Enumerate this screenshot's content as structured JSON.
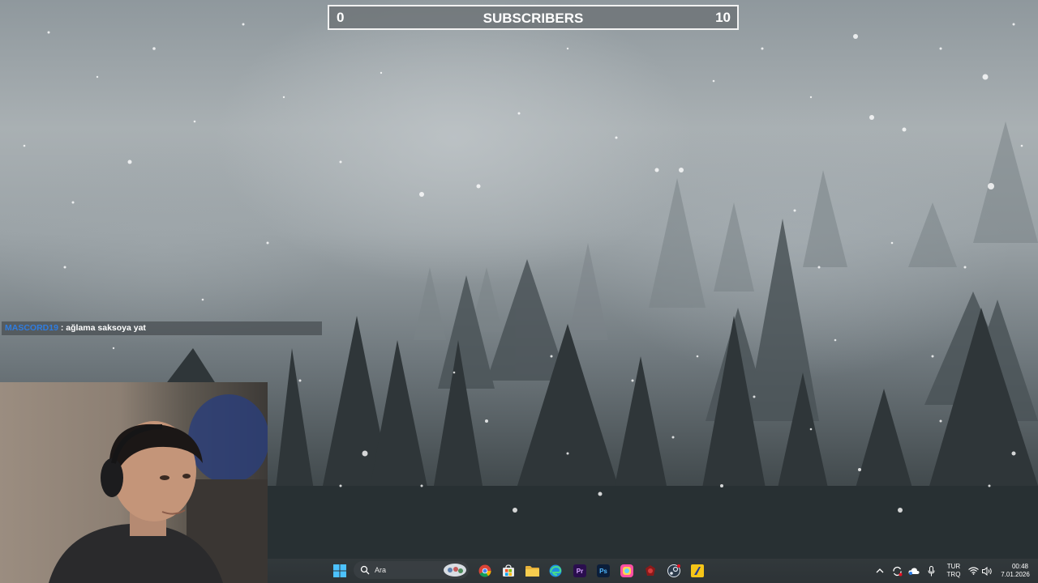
{
  "subscriber_goal": {
    "start": "0",
    "title": "SUBSCRIBERS",
    "goal": "10",
    "progress": 0
  },
  "chat": {
    "username": "MASCORD19",
    "separator": " : ",
    "message": "ağlama saksoya yat"
  },
  "taskbar": {
    "search_placeholder": "Ara",
    "apps": [
      {
        "name": "chrome",
        "label": ""
      },
      {
        "name": "microsoft-store",
        "label": ""
      },
      {
        "name": "file-explorer",
        "label": ""
      },
      {
        "name": "edge",
        "label": ""
      },
      {
        "name": "premiere-pro",
        "label": "Pr"
      },
      {
        "name": "photoshop",
        "label": "Ps"
      },
      {
        "name": "obs-color-app",
        "label": ""
      },
      {
        "name": "red-app",
        "label": ""
      },
      {
        "name": "steam-like-app",
        "label": ""
      },
      {
        "name": "yellow-app",
        "label": ""
      }
    ],
    "language_line1": "TUR",
    "language_line2": "TRQ",
    "time": "00:48",
    "date": "7.01.2026"
  }
}
